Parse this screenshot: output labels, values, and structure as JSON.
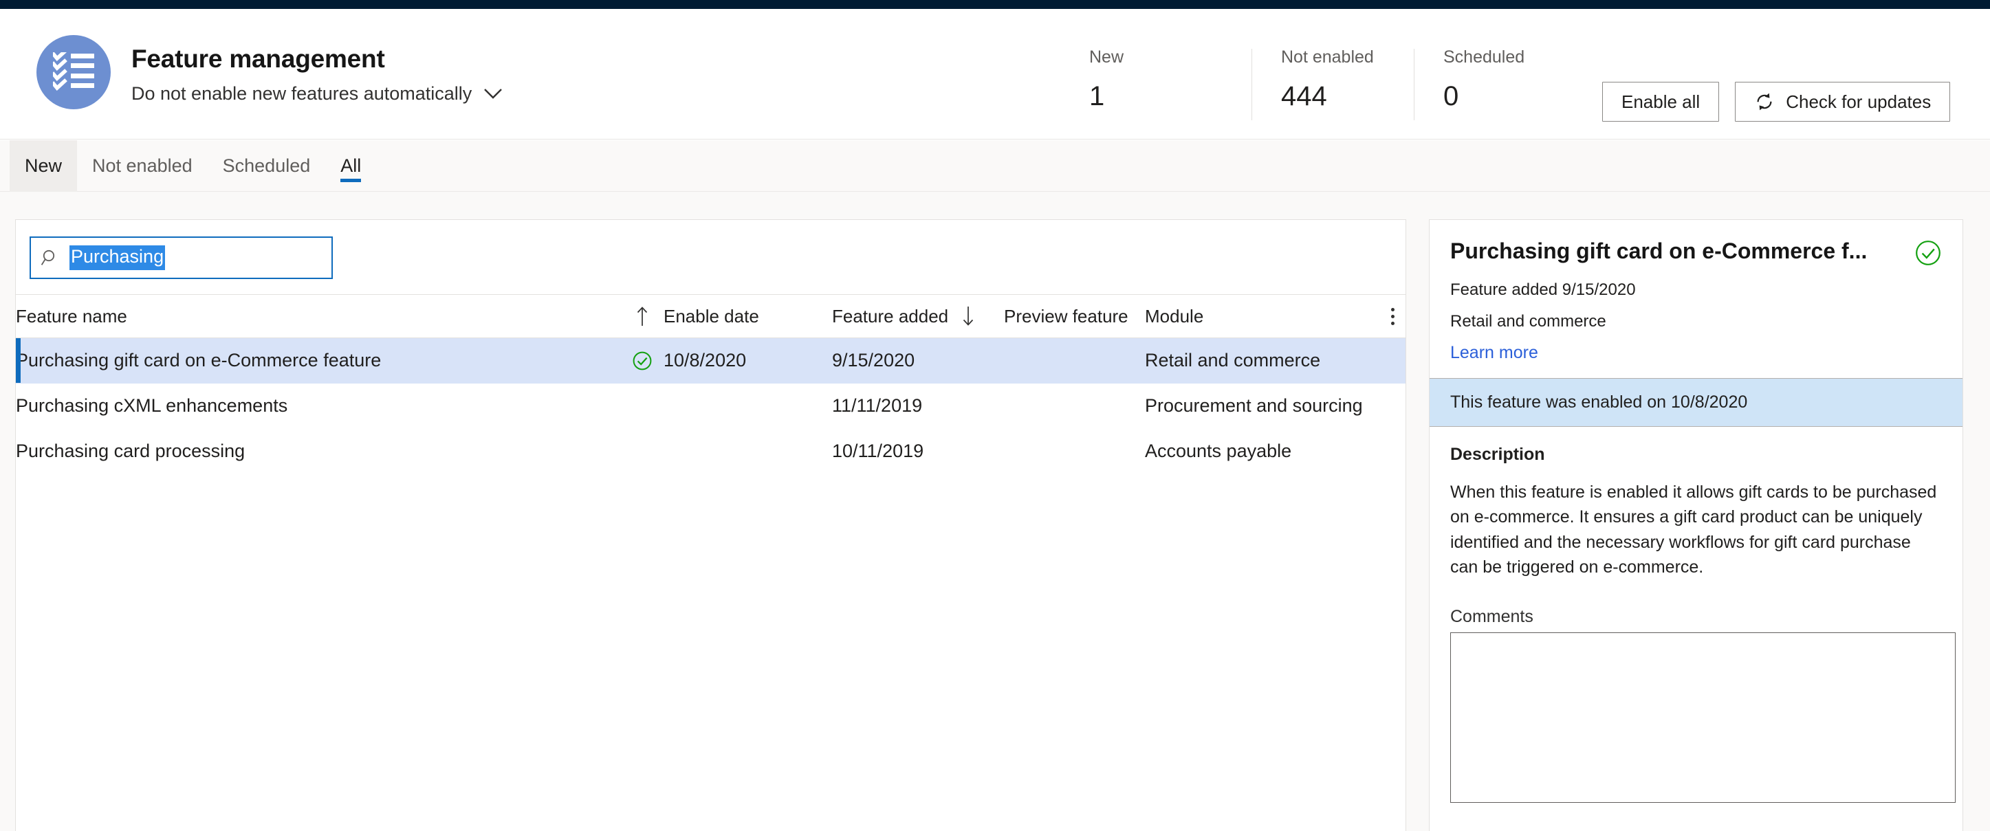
{
  "window": {
    "top_strip_color": "#001b33"
  },
  "header": {
    "avatar_icon": "checklist-icon",
    "title": "Feature management",
    "subtitle": "Do not enable new features automatically",
    "subtitle_chevron_icon": "chevron-down-icon",
    "stats": [
      {
        "label": "New",
        "value": "1"
      },
      {
        "label": "Not enabled",
        "value": "444"
      },
      {
        "label": "Scheduled",
        "value": "0"
      }
    ],
    "buttons": [
      {
        "name": "enable-all-button",
        "label": "Enable all",
        "icon": ""
      },
      {
        "name": "check-for-updates-button",
        "label": "Check for updates",
        "icon": "refresh-icon"
      }
    ]
  },
  "tabs": [
    {
      "label": "New",
      "state": "hovered"
    },
    {
      "label": "Not enabled",
      "state": "default"
    },
    {
      "label": "Scheduled",
      "state": "default"
    },
    {
      "label": "All",
      "state": "active"
    }
  ],
  "search": {
    "icon": "search-icon",
    "value": "Purchasing",
    "placeholder": "Filter",
    "selected": true,
    "focused": true
  },
  "grid": {
    "columns": [
      {
        "key": "name",
        "label": "Feature name",
        "sort": "asc"
      },
      {
        "key": "status",
        "label": "",
        "sort": ""
      },
      {
        "key": "enable",
        "label": "Enable date",
        "sort": ""
      },
      {
        "key": "added",
        "label": "Feature added",
        "sort": "desc"
      },
      {
        "key": "preview",
        "label": "Preview feature",
        "sort": ""
      },
      {
        "key": "module",
        "label": "Module",
        "sort": ""
      }
    ],
    "overflow_icon": "more-vertical-icon",
    "sort_asc_icon": "arrow-up-icon",
    "sort_desc_icon": "arrow-down-icon",
    "rows": [
      {
        "name": "Purchasing gift card on e-Commerce feature",
        "enabled_icon": "check-circle-icon",
        "enable_date": "10/8/2020",
        "feature_added": "9/15/2020",
        "preview_feature": "",
        "module": "Retail and commerce",
        "selected": true
      },
      {
        "name": "Purchasing cXML enhancements",
        "enabled_icon": "",
        "enable_date": "",
        "feature_added": "11/11/2019",
        "preview_feature": "",
        "module": "Procurement and sourcing",
        "selected": false
      },
      {
        "name": "Purchasing card processing",
        "enabled_icon": "",
        "enable_date": "",
        "feature_added": "10/11/2019",
        "preview_feature": "",
        "module": "Accounts payable",
        "selected": false
      }
    ]
  },
  "detail": {
    "title": "Purchasing gift card on e-Commerce f...",
    "status_icon": "check-circle-icon",
    "added_line": "Feature added 9/15/2020",
    "module_line": "Retail and commerce",
    "learn_more": "Learn more",
    "banner": "This feature was enabled on 10/8/2020",
    "description_heading": "Description",
    "description": "When this feature is enabled it allows gift cards to be purchased on e-commerce. It ensures a gift card product can be uniquely identified and the necessary workflows for gift card purchase can be triggered on e-commerce.",
    "comments_label": "Comments",
    "comments_value": "",
    "comments_placeholder": ""
  },
  "colors": {
    "accent": "#0f6cbd",
    "selected_row": "#d8e3f8",
    "banner": "#cfe4f7",
    "success": "#107c10",
    "link": "#2b5fd9",
    "avatar": "#6d8fd1",
    "page_bg": "#faf9f8"
  }
}
